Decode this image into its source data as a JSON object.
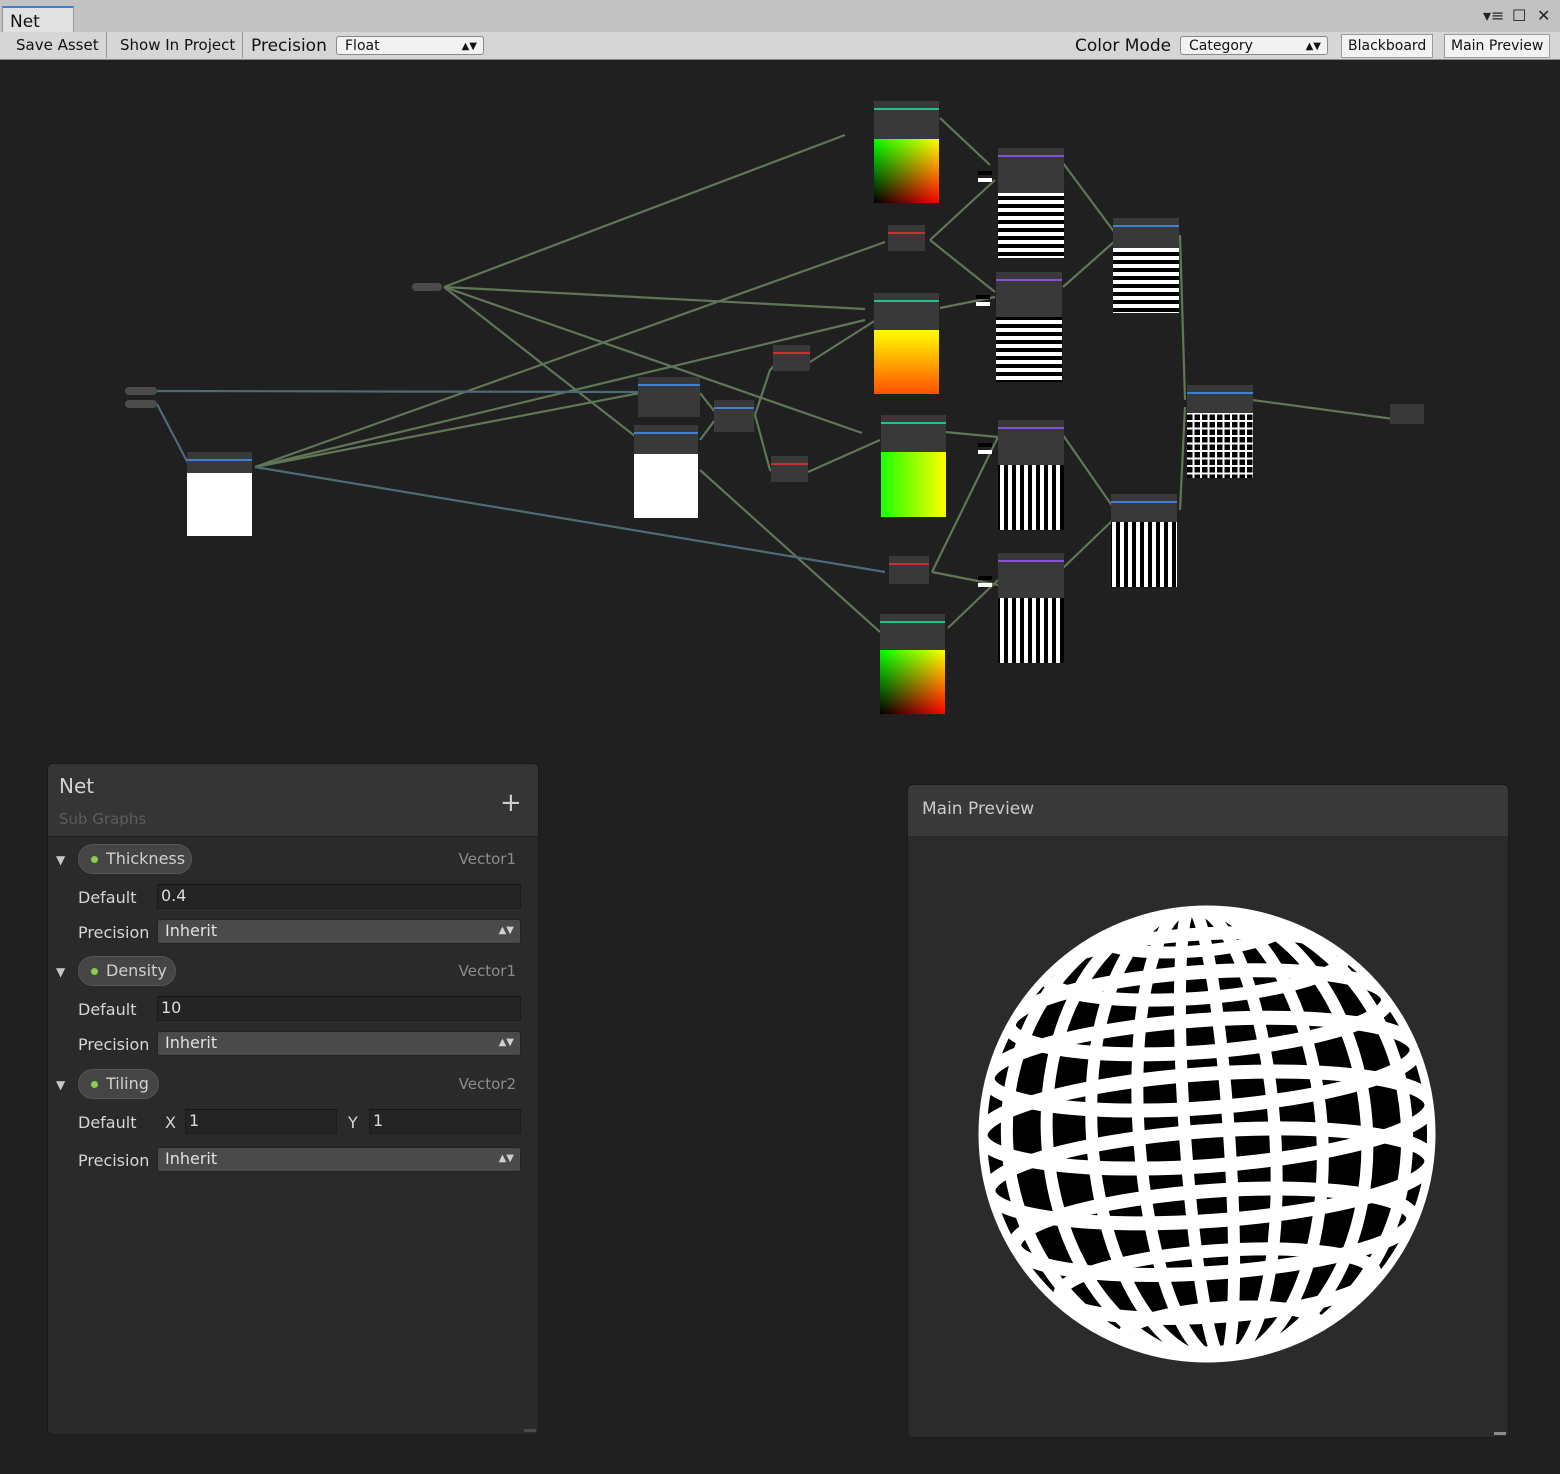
{
  "window": {
    "tab_title": "Net",
    "controls": {
      "menu_icon": "▾≡",
      "maximize_icon": "☐",
      "close_icon": "✕"
    }
  },
  "toolbar": {
    "save_asset": "Save Asset",
    "show_in_project": "Show In Project",
    "precision_label": "Precision",
    "precision_value": "Float",
    "color_mode_label": "Color Mode",
    "color_mode_value": "Category",
    "blackboard": "Blackboard",
    "main_preview": "Main Preview"
  },
  "blackboard": {
    "title": "Net",
    "subtitle": "Sub Graphs",
    "add_icon": "+",
    "properties": [
      {
        "name": "Thickness",
        "type": "Vector1",
        "default_label": "Default",
        "default": "0.4",
        "precision_label": "Precision",
        "precision": "Inherit"
      },
      {
        "name": "Density",
        "type": "Vector1",
        "default_label": "Default",
        "default": "10",
        "precision_label": "Precision",
        "precision": "Inherit"
      },
      {
        "name": "Tiling",
        "type": "Vector2",
        "default_label": "Default",
        "x_label": "X",
        "x": "1",
        "y_label": "Y",
        "y": "1",
        "precision_label": "Precision",
        "precision": "Inherit"
      }
    ]
  },
  "main_preview": {
    "title": "Main Preview"
  },
  "colors": {
    "graph_background": "#202020",
    "edge_color": "#6a7d5e",
    "edge_color_alt": "#5a7480",
    "uv_header": "#1fc08a",
    "math_header": "#3f7fd4",
    "procedural_header": "#8b4fd6",
    "vector_header": "#c93030",
    "property_dot": "#8fc951"
  }
}
